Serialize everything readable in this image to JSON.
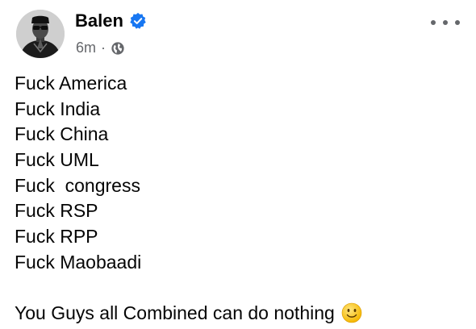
{
  "author": {
    "name": "Balen",
    "verified_icon": "verified-badge-icon",
    "timestamp": "6m",
    "separator": "·",
    "audience_icon": "globe-icon"
  },
  "menu": {
    "icon": "more-horizontal-icon"
  },
  "post": {
    "lines": [
      "Fuck America",
      "Fuck India",
      "Fuck China",
      "Fuck UML",
      "Fuck  congress",
      "Fuck RSP",
      "Fuck RPP",
      "Fuck Maobaadi"
    ],
    "closing": "You Guys all Combined can do nothing",
    "closing_emoji": "slightly-smiling-face-icon"
  },
  "colors": {
    "text_primary": "#050505",
    "text_secondary": "#65676b",
    "verified_blue": "#1877f2",
    "background": "#ffffff"
  }
}
